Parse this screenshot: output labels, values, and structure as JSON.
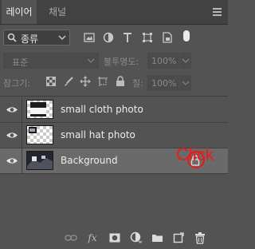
{
  "tabs": [
    {
      "label": "레이어"
    },
    {
      "label": "채널"
    }
  ],
  "filter": {
    "kind_label": "종류"
  },
  "blend": {
    "mode": "표준",
    "opacity_label": "불투명도:",
    "opacity_value": "100%"
  },
  "lock": {
    "label": "잠그기:",
    "fill_label": "칠:",
    "fill_value": "100%"
  },
  "layers": [
    {
      "name": "small cloth photo",
      "visible": true,
      "selected": false,
      "locked": false
    },
    {
      "name": "small hat photo",
      "visible": true,
      "selected": false,
      "locked": false
    },
    {
      "name": "Background",
      "visible": true,
      "selected": true,
      "locked": true
    }
  ],
  "annotation": {
    "text": "Click",
    "color": "#e51a1a"
  },
  "colors": {
    "panel_bg": "#535353",
    "selected_row": "#6a6a6a"
  },
  "icons": {
    "filter_icons": [
      "image-filter-icon",
      "adjustment-filter-icon",
      "type-filter-icon",
      "shape-filter-icon",
      "smart-object-filter-icon"
    ],
    "lock_icons": [
      "lock-transparent-pixels-icon",
      "lock-image-pixels-icon",
      "lock-position-icon",
      "prevent-autonest-icon",
      "lock-all-icon"
    ],
    "bottom_icons": [
      "link-layers-icon",
      "fx-icon",
      "add-mask-icon",
      "adjustment-layer-icon",
      "new-group-icon",
      "new-layer-icon",
      "delete-layer-icon"
    ]
  }
}
